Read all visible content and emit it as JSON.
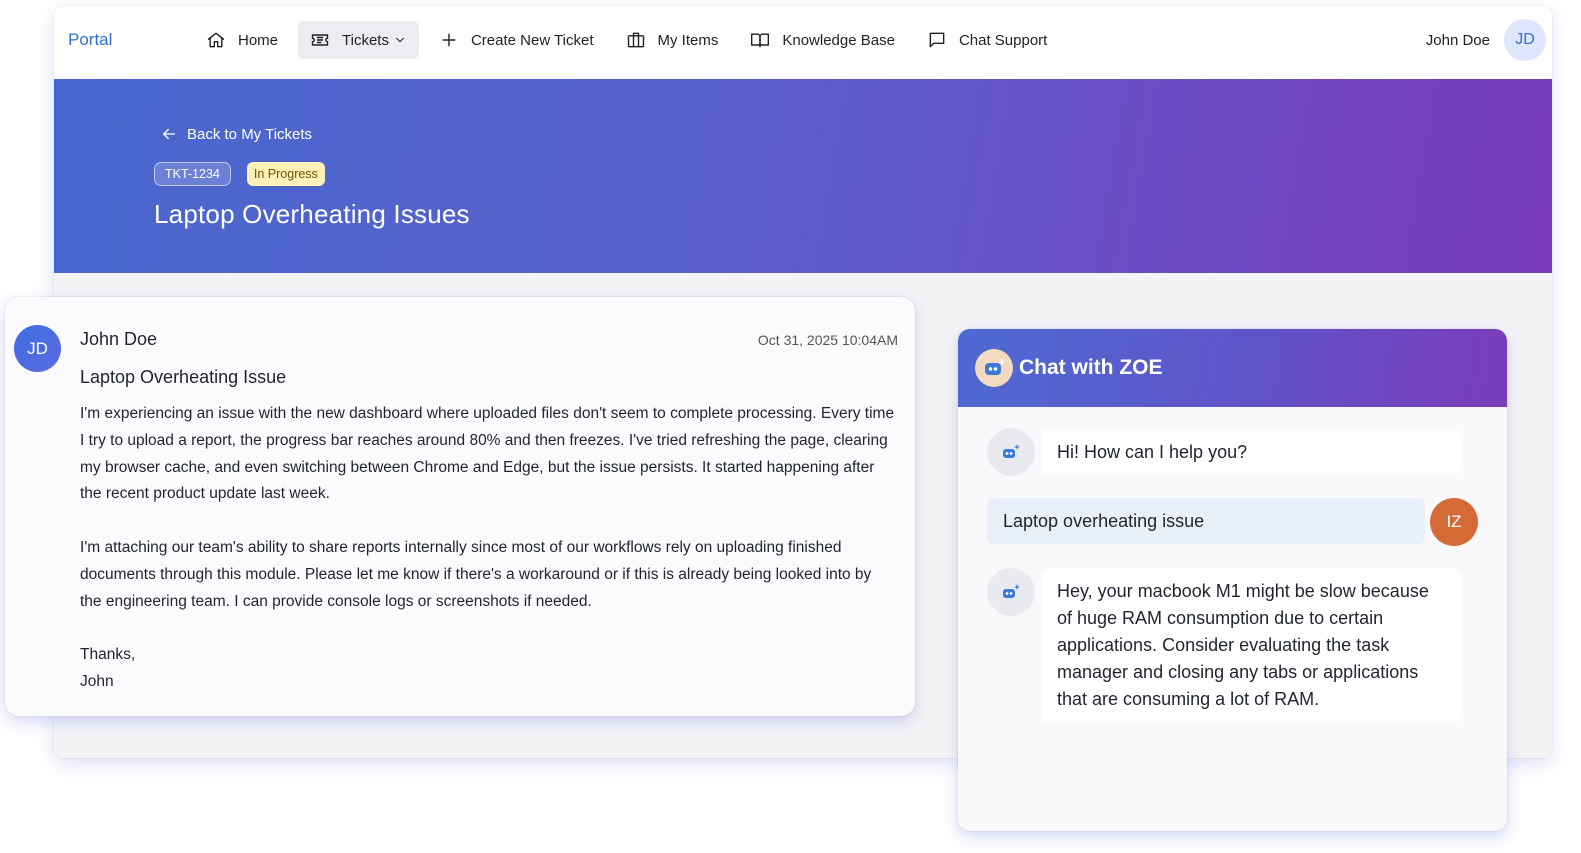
{
  "nav": {
    "brand": "Portal",
    "items": [
      {
        "label": "Home",
        "icon": "home-icon"
      },
      {
        "label": "Tickets",
        "icon": "ticket-icon"
      },
      {
        "label": "Create New Ticket",
        "icon": "plus-icon"
      },
      {
        "label": "My Items",
        "icon": "briefcase-icon"
      },
      {
        "label": "Knowledge Base",
        "icon": "book-icon"
      },
      {
        "label": "Chat Support",
        "icon": "chat-icon"
      }
    ],
    "active": "Tickets",
    "user_name": "John Doe",
    "user_initials": "JD"
  },
  "banner": {
    "back_label": "Back to My Tickets",
    "ticket_id": "TKT-1234",
    "status": "In Progress",
    "title": "Laptop Overheating Issues"
  },
  "message": {
    "author_initials": "JD",
    "author": "John Doe",
    "timestamp": "Oct 31, 2025 10:04AM",
    "subject": "Laptop Overheating Issue",
    "paragraphs": [
      "I'm experiencing an issue with the new dashboard where uploaded files don't seem to complete processing. Every time I try to upload a report, the progress bar reaches around 80% and then freezes. I've tried refreshing the page, clearing my browser cache, and even switching between Chrome and Edge, but the issue persists. It started happening after the recent product update last week.",
      "I'm attaching our team's ability to share reports internally since most of our workflows rely on uploading finished documents through this module. Please let me know if there's a workaround or if this is already being looked into by the engineering team. I can provide console logs or screenshots if needed.",
      "Thanks,",
      "John"
    ]
  },
  "chat": {
    "title": "Chat with ZOE",
    "messages": [
      {
        "from": "bot",
        "text": "Hi! How can I help you?"
      },
      {
        "from": "user",
        "text": "Laptop overheating issue",
        "initials": "IZ"
      },
      {
        "from": "bot",
        "text": "Hey, your macbook M1 might be slow because of huge RAM consumption due to certain applications. Consider evaluating the task manager and closing any tabs or applications that are consuming a lot of RAM."
      }
    ]
  },
  "colors": {
    "accent": "#2f6fd6",
    "banner_start": "#4868cf",
    "banner_end": "#7a3bb8",
    "status_bg": "#fdf1b8",
    "user_avatar": "#d46a36"
  }
}
